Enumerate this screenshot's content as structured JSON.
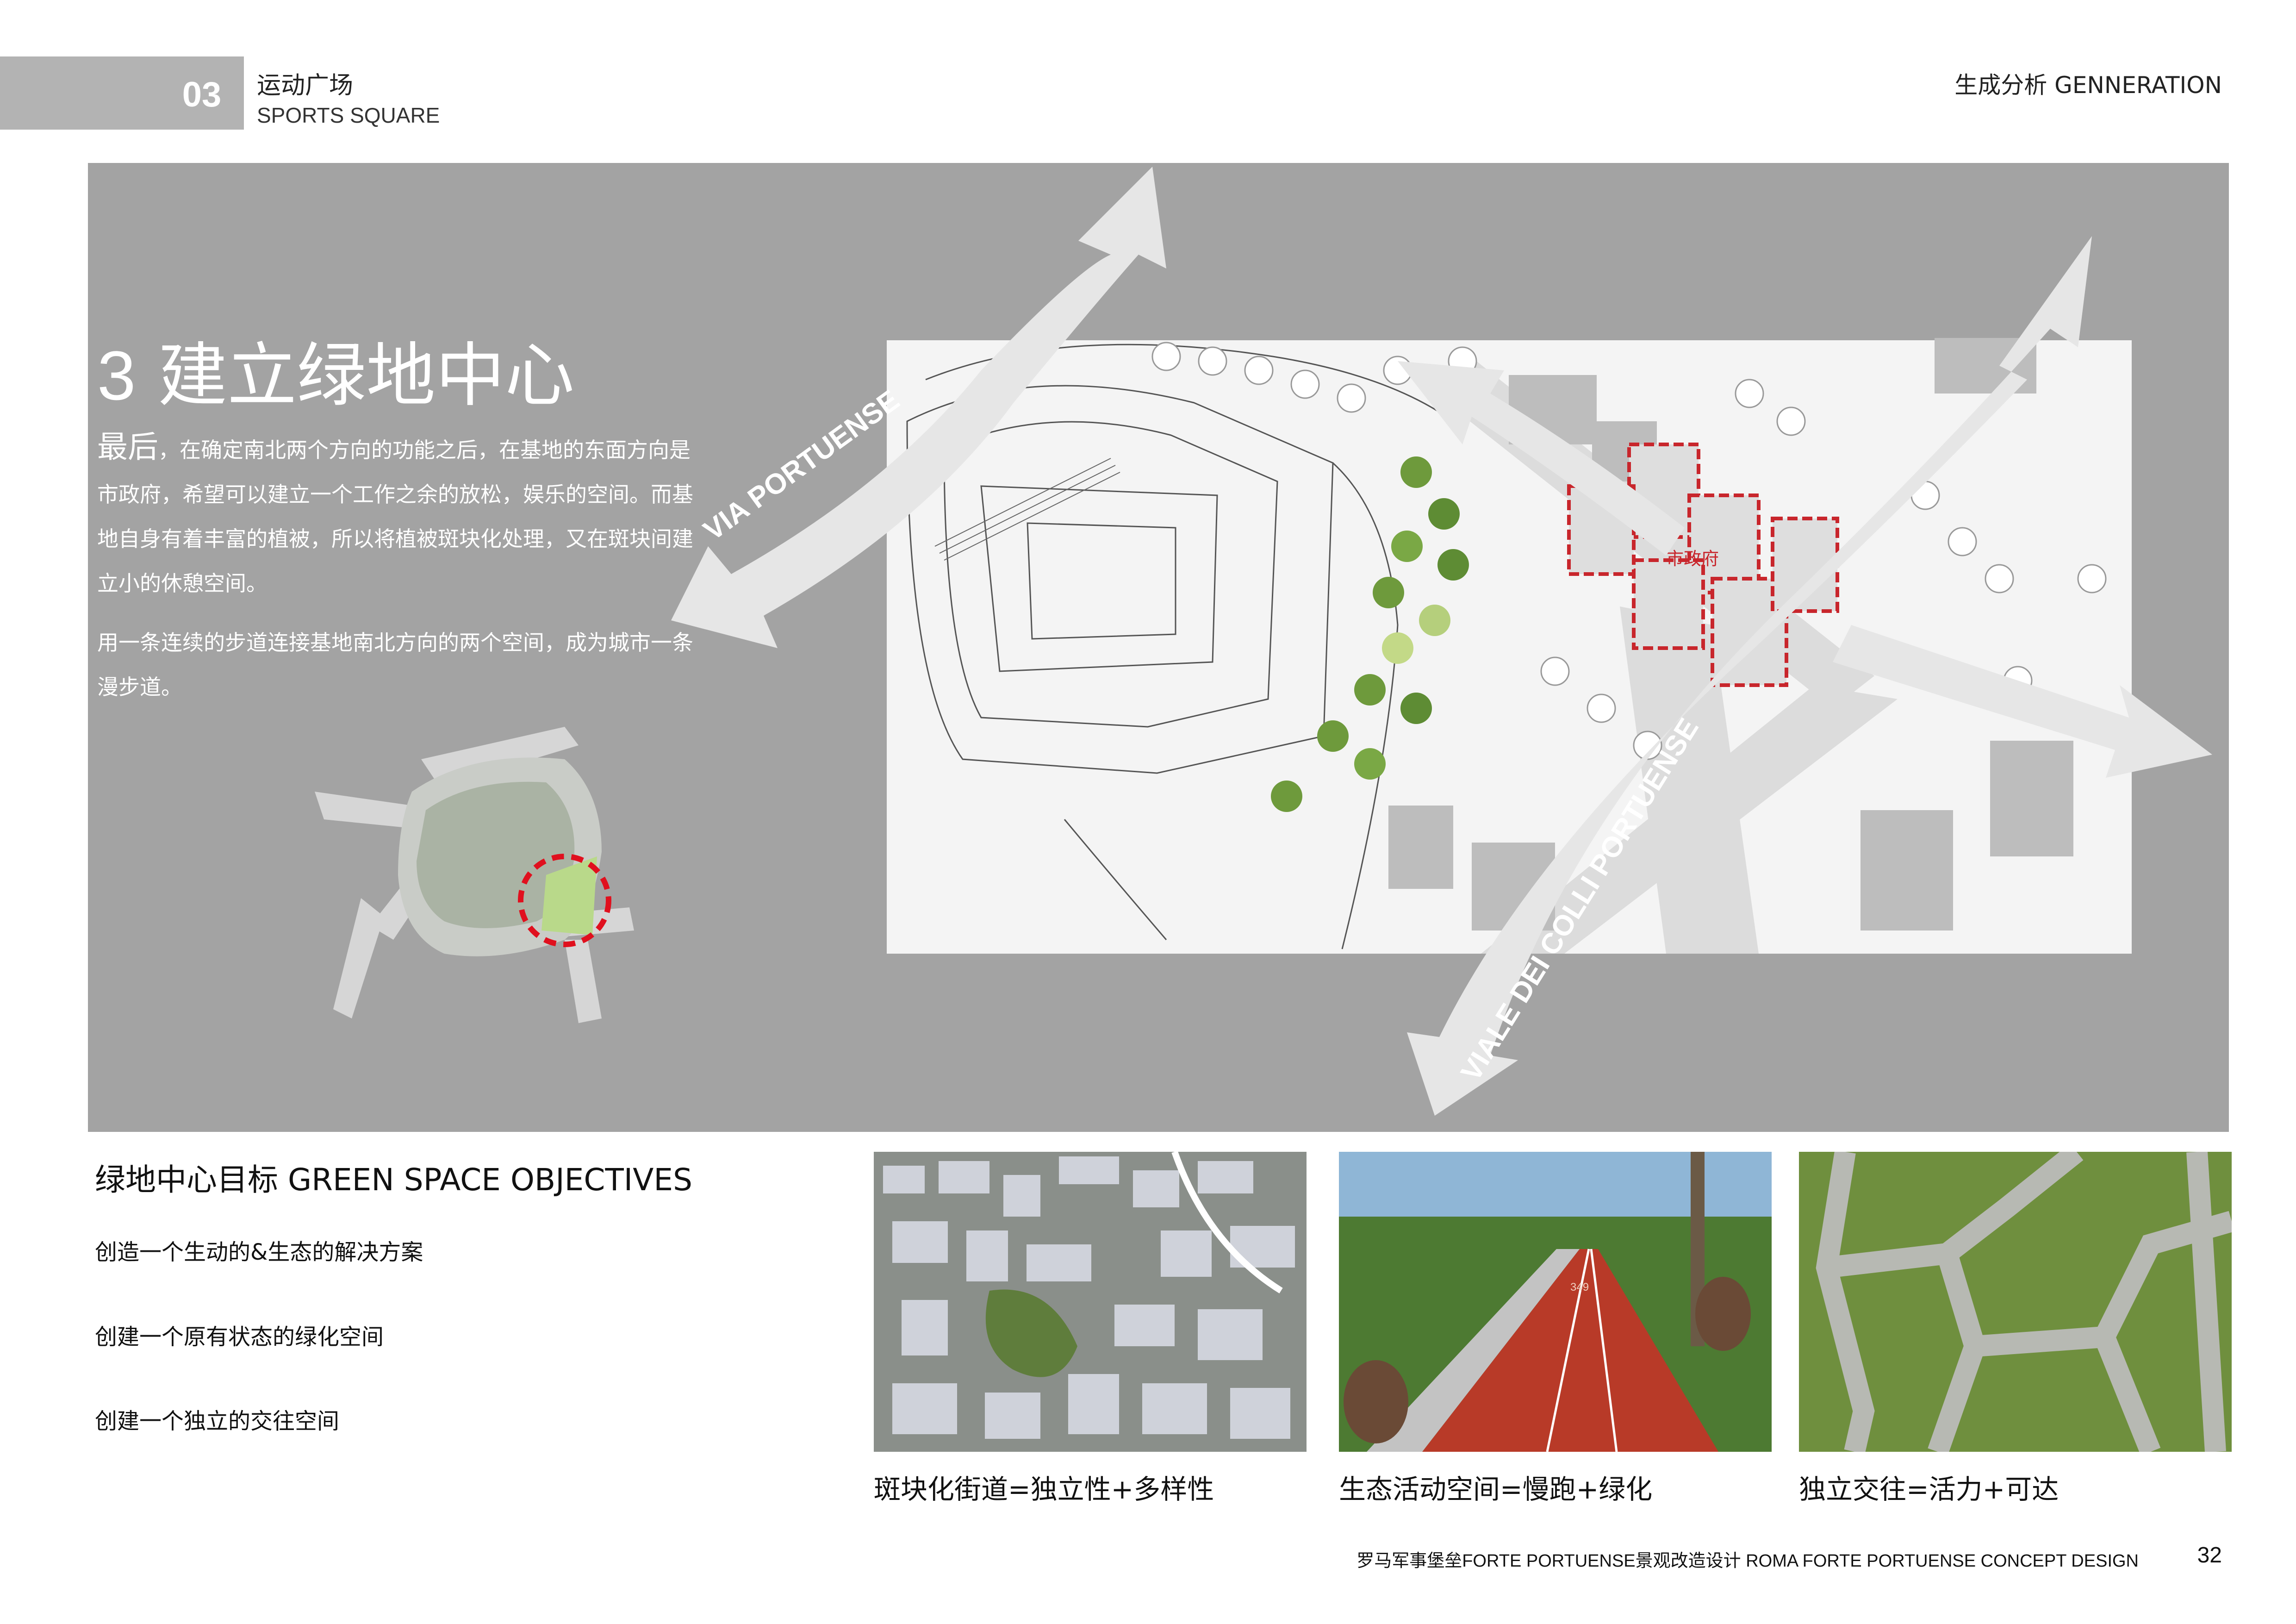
{
  "header": {
    "section_number": "03",
    "title_cn": "运动广场",
    "title_en": "SPORTS SQUARE",
    "right_label": "生成分析 GENNERATION"
  },
  "main": {
    "step_number": "3",
    "step_title": "建立绿地中心",
    "paragraph1_lead": "最后",
    "paragraph1_rest": "，在确定南北两个方向的功能之后，在基地的东面方向是市政府，希望可以建立一个工作之余的放松，娱乐的空间。而基地自身有着丰富的植被，所以将植被斑块化处理，又在斑块间建立小的休憩空间。",
    "paragraph2": "用一条连续的步道连接基地南北方向的两个空间，成为城市一条漫步道。",
    "map_labels": {
      "road_west": "VIA PORTUENSE",
      "road_south": "VIALE DEI COLLI PORTUENSE",
      "city_hall": "市政府"
    }
  },
  "objectives": {
    "title": "绿地中心目标  GREEN SPACE OBJECTIVES",
    "items": [
      "创造一个生动的&生态的解决方案",
      "创建一个原有状态的绿化空间",
      "创建一个独立的交往空间"
    ]
  },
  "photos": {
    "captions": [
      "斑块化街道=独立性+多样性",
      "生态活动空间=慢跑+绿化",
      "独立交往=活力+可达"
    ],
    "track_sign": "349"
  },
  "footer": {
    "project": "罗马军事堡垒FORTE PORTUENSE景观改造设计 ROMA FORTE PORTUENSE CONCEPT DESIGN",
    "page": "32"
  },
  "colors": {
    "panel_gray": "#a3a3a3",
    "header_band": "#b3b3b3",
    "city_hall_red": "#c8262c",
    "locator_red": "#e0101e",
    "track_red": "#b83a28"
  }
}
